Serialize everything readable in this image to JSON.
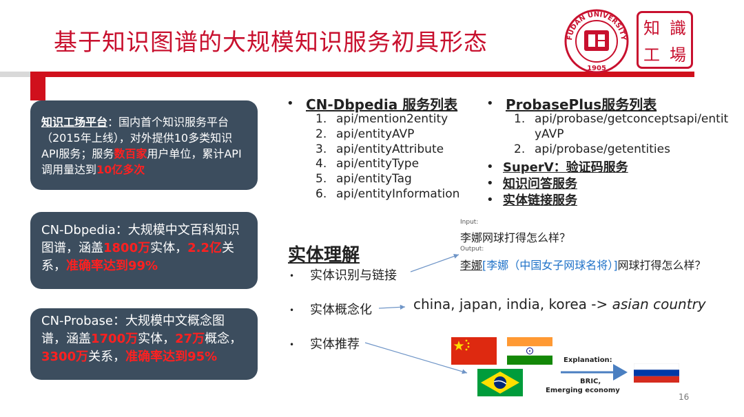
{
  "title": "基于知识图谱的大规模知识服务初具形态",
  "logos": {
    "fudan_text": "FUDAN UNIVERSITY",
    "fudan_year": "1905",
    "zg_chars": [
      "知",
      "識",
      "工",
      "場"
    ]
  },
  "left_boxes": {
    "box1": {
      "head": "知识工场平台",
      "p1": "：国内首个知识服务平台（2015年上线），对外提供10多类知识API服务；服务",
      "hl1": "数百家",
      "p2": "用户单位，累计API调用量达到",
      "hl2": "10亿多次"
    },
    "box2": {
      "p1": "CN-Dbpedia：大规模中文百科知识图谱，涵盖",
      "hl1": "1800万",
      "p2": "实体，",
      "hl2": "2.2亿",
      "p3": "关系，",
      "hl3": "准确率达到99%"
    },
    "box3": {
      "p1": "CN-Probase：大规模中文概念图谱，涵盖",
      "hl1": "1700万",
      "p2": "实体，",
      "hl2": "27万",
      "p3": "概念，",
      "hl3": "3300万",
      "p4": "关系，",
      "hl4": "准确率达到95%"
    }
  },
  "dbpedia": {
    "bullet": "•",
    "heading": "CN-Dbpedia 服务列表",
    "items": [
      {
        "num": "1.",
        "text": "api/mention2entity"
      },
      {
        "num": "2.",
        "text": "api/entityAVP"
      },
      {
        "num": "3.",
        "text": "api/entityAttribute"
      },
      {
        "num": "4.",
        "text": "api/entityType"
      },
      {
        "num": "5.",
        "text": "api/entityTag"
      },
      {
        "num": "6.",
        "text": "api/entityInformation"
      }
    ]
  },
  "probase": {
    "bullet": "•",
    "heading": "ProbasePlus服务列表",
    "items": [
      {
        "num": "1.",
        "text": "api/probase/getconceptsapi/entit"
      },
      {
        "num": "",
        "text": "yAVP"
      },
      {
        "num": "2.",
        "text": "api/probase/getentities"
      }
    ],
    "services": [
      "SuperV：验证码服务",
      "知识问答服务",
      "实体链接服务"
    ]
  },
  "entity": {
    "title": "实体理解",
    "items": [
      "实体识别与链接",
      "实体概念化",
      "实体推荐"
    ],
    "input_label": "Input:",
    "input_text": "李娜网球打得怎么样？",
    "output_label": "Output:",
    "output_mention": "李娜",
    "output_link": "[李娜（中国女子网球名将）]",
    "output_rest": "网球打得怎么样？",
    "concept_input": "china, japan, india, korea ->",
    "concept_output": "asian country",
    "explanation_label": "Explanation:",
    "explanation_line1": "BRIC,",
    "explanation_line2": "Emerging economy"
  },
  "page_number": "16",
  "colors": {
    "accent": "#c8102e",
    "box_bg": "#3c4d5e",
    "highlight": "#ff2020",
    "link_blue": "#1f72c8"
  }
}
